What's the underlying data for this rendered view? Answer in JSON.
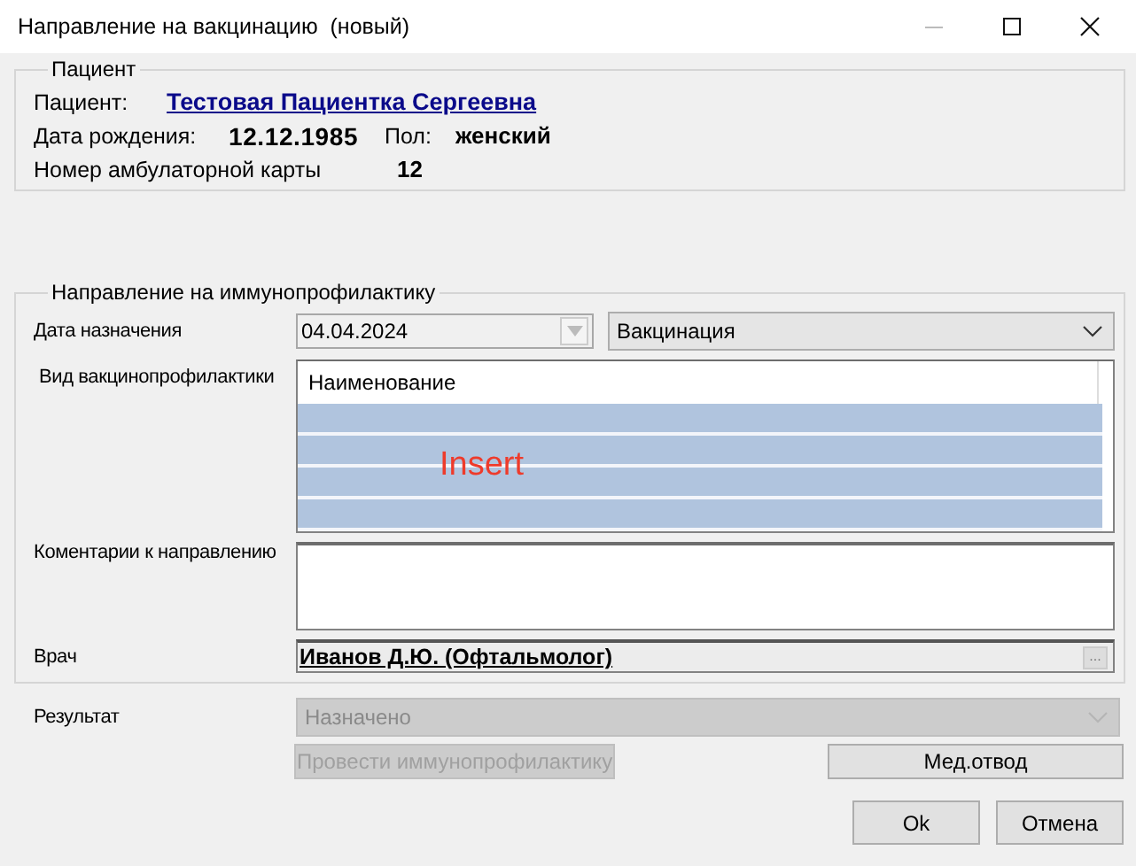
{
  "window": {
    "title": "Направление на вакцинацию  (новый)"
  },
  "patient": {
    "legend": "Пациент",
    "name_label": "Пациент:",
    "name": "Тестовая Пациентка Сергеевна",
    "birth_label": "Дата рождения:",
    "birth_date": "12.12.1985",
    "sex_label": "Пол:",
    "sex": "женский",
    "card_label": "Номер амбулаторной карты",
    "card_number": "12"
  },
  "referral": {
    "legend": "Направление на иммунопрофилактику",
    "date_label": "Дата назначения",
    "date": {
      "value": "04.04.2024",
      "disabled": true
    },
    "type": {
      "value": "Вакцинация",
      "disabled": false
    },
    "vaccine_label": "Вид вакцинопрофилактики",
    "table": {
      "columns": [
        "Наименование"
      ],
      "overlay": "Insert"
    },
    "comment_label": "Коментарии к направлению",
    "doctor_label": "Врач",
    "doctor": "Иванов Д.Ю. (Офтальмолог)",
    "doctor_button": "..."
  },
  "result": {
    "label": "Результат",
    "value": "Назначено",
    "disabled": true
  },
  "buttons": [
    {
      "label": "Провести иммунопрофилактику",
      "disabled": true,
      "kind": "action"
    },
    {
      "label": "Мед.отвод",
      "disabled": false,
      "kind": "action"
    },
    {
      "label": "Ok",
      "disabled": false,
      "kind": "dialog"
    },
    {
      "label": "Отмена",
      "disabled": false,
      "kind": "dialog"
    }
  ]
}
